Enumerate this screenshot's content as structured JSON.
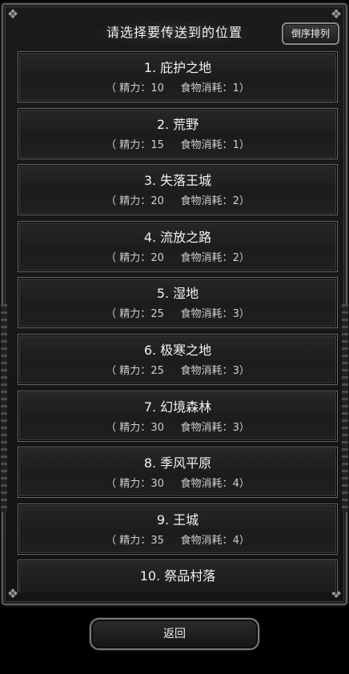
{
  "header": {
    "title": "请选择要传送到的位置",
    "sort_label": "倒序排列"
  },
  "locations": [
    {
      "name": "1. 庇护之地",
      "energy_label": "精力",
      "energy": "10",
      "food_label": "食物消耗",
      "food": "1"
    },
    {
      "name": "2. 荒野",
      "energy_label": "精力",
      "energy": "15",
      "food_label": "食物消耗",
      "food": "1"
    },
    {
      "name": "3. 失落王城",
      "energy_label": "精力",
      "energy": "20",
      "food_label": "食物消耗",
      "food": "2"
    },
    {
      "name": "4. 流放之路",
      "energy_label": "精力",
      "energy": "20",
      "food_label": "食物消耗",
      "food": "2"
    },
    {
      "name": "5. 湿地",
      "energy_label": "精力",
      "energy": "25",
      "food_label": "食物消耗",
      "food": "3"
    },
    {
      "name": "6. 极寒之地",
      "energy_label": "精力",
      "energy": "25",
      "food_label": "食物消耗",
      "food": "3"
    },
    {
      "name": "7. 幻境森林",
      "energy_label": "精力",
      "energy": "30",
      "food_label": "食物消耗",
      "food": "3"
    },
    {
      "name": "8. 季风平原",
      "energy_label": "精力",
      "energy": "30",
      "food_label": "食物消耗",
      "food": "4"
    },
    {
      "name": "9. 王城",
      "energy_label": "精力",
      "energy": "35",
      "food_label": "食物消耗",
      "food": "4"
    },
    {
      "name": "10. 祭品村落",
      "energy_label": "",
      "energy": "",
      "food_label": "",
      "food": ""
    }
  ],
  "footer": {
    "back_label": "返回"
  }
}
